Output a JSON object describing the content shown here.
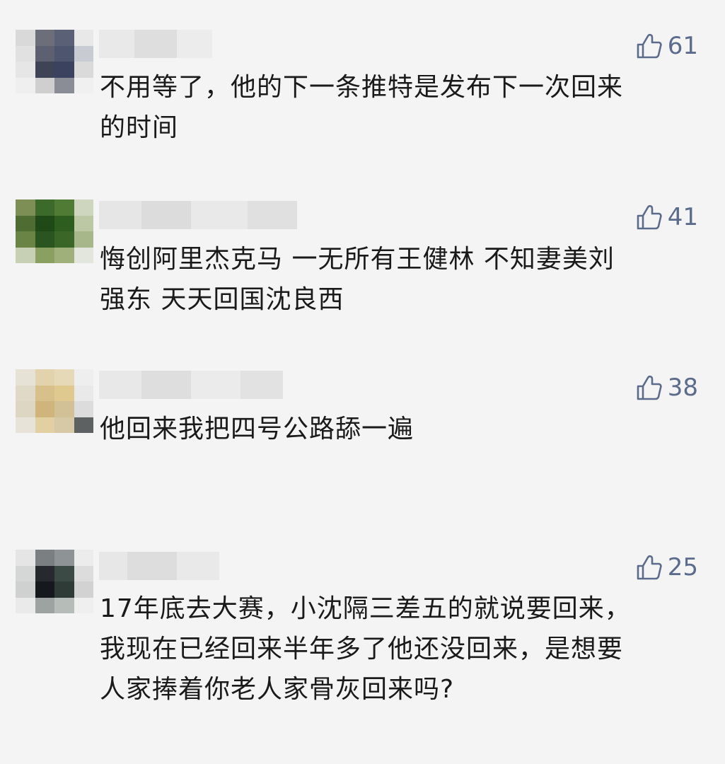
{
  "comments": [
    {
      "likes": "61",
      "text": "不用等了，他的下一条推特是发布下一次回来\n的时间"
    },
    {
      "likes": "41",
      "text": "悔创阿里杰克马  一无所有王健林  不知妻美刘\n强东  天天回国沈良西"
    },
    {
      "likes": "38",
      "text": "他回来我把四号公路舔一遍"
    },
    {
      "likes": "25",
      "text": "17年底去大赛，小沈隔三差五的就说要回来，\n我现在已经回来半年多了他还没回来，是想要\n人家捧着你老人家骨灰回来吗?"
    }
  ],
  "icons": {
    "like": "thumbs-up-icon"
  },
  "colors": {
    "like": "#5b6b8c",
    "text": "#1a1a1a",
    "background": "#f4f4f4"
  }
}
